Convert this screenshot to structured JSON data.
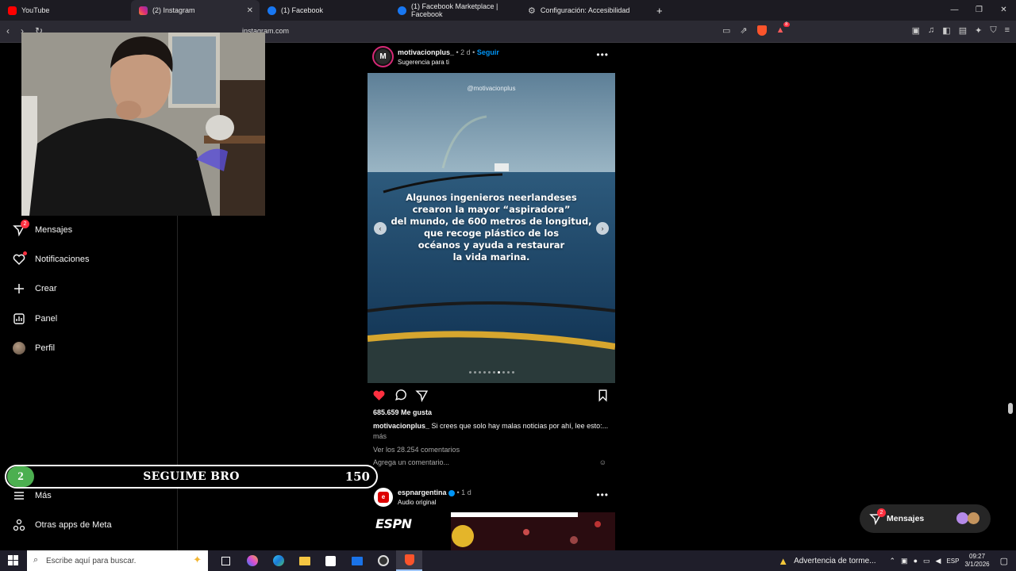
{
  "browser": {
    "tabs": [
      {
        "label": "YouTube",
        "active": false,
        "color": "#ff0000"
      },
      {
        "label": "(2) Instagram",
        "active": true,
        "color": "#e1306c"
      },
      {
        "label": "(1) Facebook",
        "active": false,
        "color": "#1877f2"
      },
      {
        "label": "(1) Facebook Marketplace | Facebook",
        "active": false,
        "color": "#1877f2"
      },
      {
        "label": "Configuración: Accesibilidad",
        "active": false,
        "color": "#aaaaaa"
      }
    ],
    "new_tab": "+",
    "url": "instagram.com",
    "shield_badge": "8"
  },
  "sidebar": {
    "items": [
      {
        "label": "Mensajes",
        "icon": "messages-icon",
        "badge": "2"
      },
      {
        "label": "Notificaciones",
        "icon": "heart-icon"
      },
      {
        "label": "Crear",
        "icon": "plus-icon"
      },
      {
        "label": "Panel",
        "icon": "chart-icon"
      },
      {
        "label": "Perfil",
        "icon": "avatar"
      },
      {
        "label": "Más",
        "icon": "menu-icon"
      },
      {
        "label": "Otras apps de Meta",
        "icon": "meta-apps-icon"
      }
    ]
  },
  "banner": {
    "number": "2",
    "text": "SEGUIME BRO",
    "count": "150"
  },
  "post": {
    "avatar_letter": "M",
    "username": "motivacionplus_",
    "time": " • 2 d • ",
    "follow": "Seguir",
    "suggestion": "Sugerencia para ti",
    "watermark": "@motivacionplus",
    "image_text": [
      "Algunos ingenieros neerlandeses",
      "crearon la mayor “aspiradora”",
      "del mundo, de 600 metros de longitud,",
      "que recoge plástico de los",
      "océanos y ayuda a restaurar",
      "la vida marina."
    ],
    "carousel_index": 6,
    "carousel_total": 10,
    "likes": "685.659 Me gusta",
    "caption_user": "motivacionplus_",
    "caption_text": " Si crees que solo hay malas noticias por ahí, lee esto:...",
    "more": "más",
    "view_comments": "Ver los 28.254 comentarios",
    "add_comment_placeholder": "Agrega un comentario..."
  },
  "post2": {
    "username": "espnargentina",
    "time": " • 1 d",
    "audio": "Audio original",
    "logo": "ESPN"
  },
  "messages_pill": {
    "label": "Mensajes",
    "badge": "2"
  },
  "taskbar": {
    "search_placeholder": "Escribe aquí para buscar.",
    "weather": "Advertencia de torme...",
    "lang": "ESP",
    "time": "09:27",
    "date": "3/1/2026"
  },
  "colors": {
    "accent": "#0095f6",
    "like": "#ff3040",
    "bg": "#000000"
  }
}
